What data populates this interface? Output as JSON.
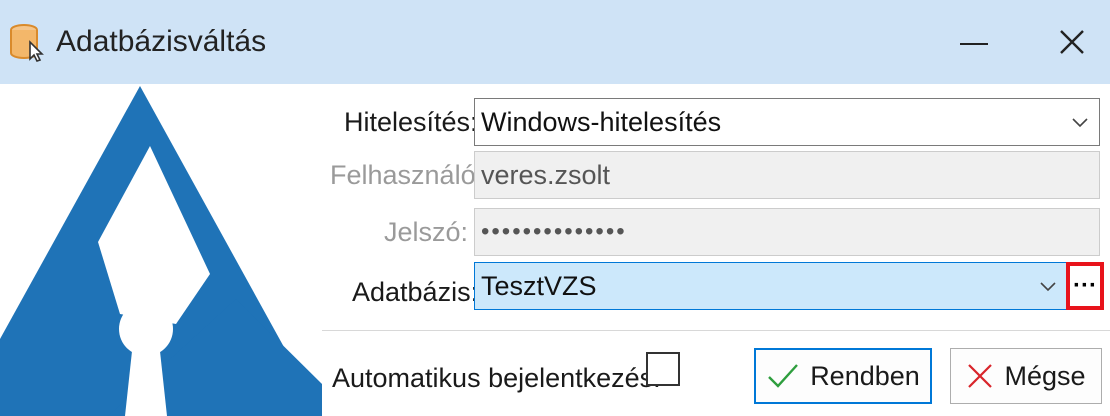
{
  "window": {
    "title": "Adatbázisváltás"
  },
  "form": {
    "auth_label": "Hitelesítés:",
    "auth_value": "Windows-hitelesítés",
    "user_label": "Felhasználó:",
    "user_value": "veres.zsolt",
    "password_label": "Jelszó:",
    "password_value": "••••••••••••••",
    "database_label": "Adatbázis:",
    "database_value": "TesztVZS",
    "browse_label": "···",
    "autologin_label": "Automatikus bejelentkezés:",
    "autologin_checked": false
  },
  "buttons": {
    "ok_label": "Rendben",
    "cancel_label": "Mégse"
  },
  "colors": {
    "titlebar": "#cfe3f6",
    "logo_blue": "#1f73b7",
    "highlight_red": "#e8131b",
    "selected_field": "#cce8fb"
  }
}
